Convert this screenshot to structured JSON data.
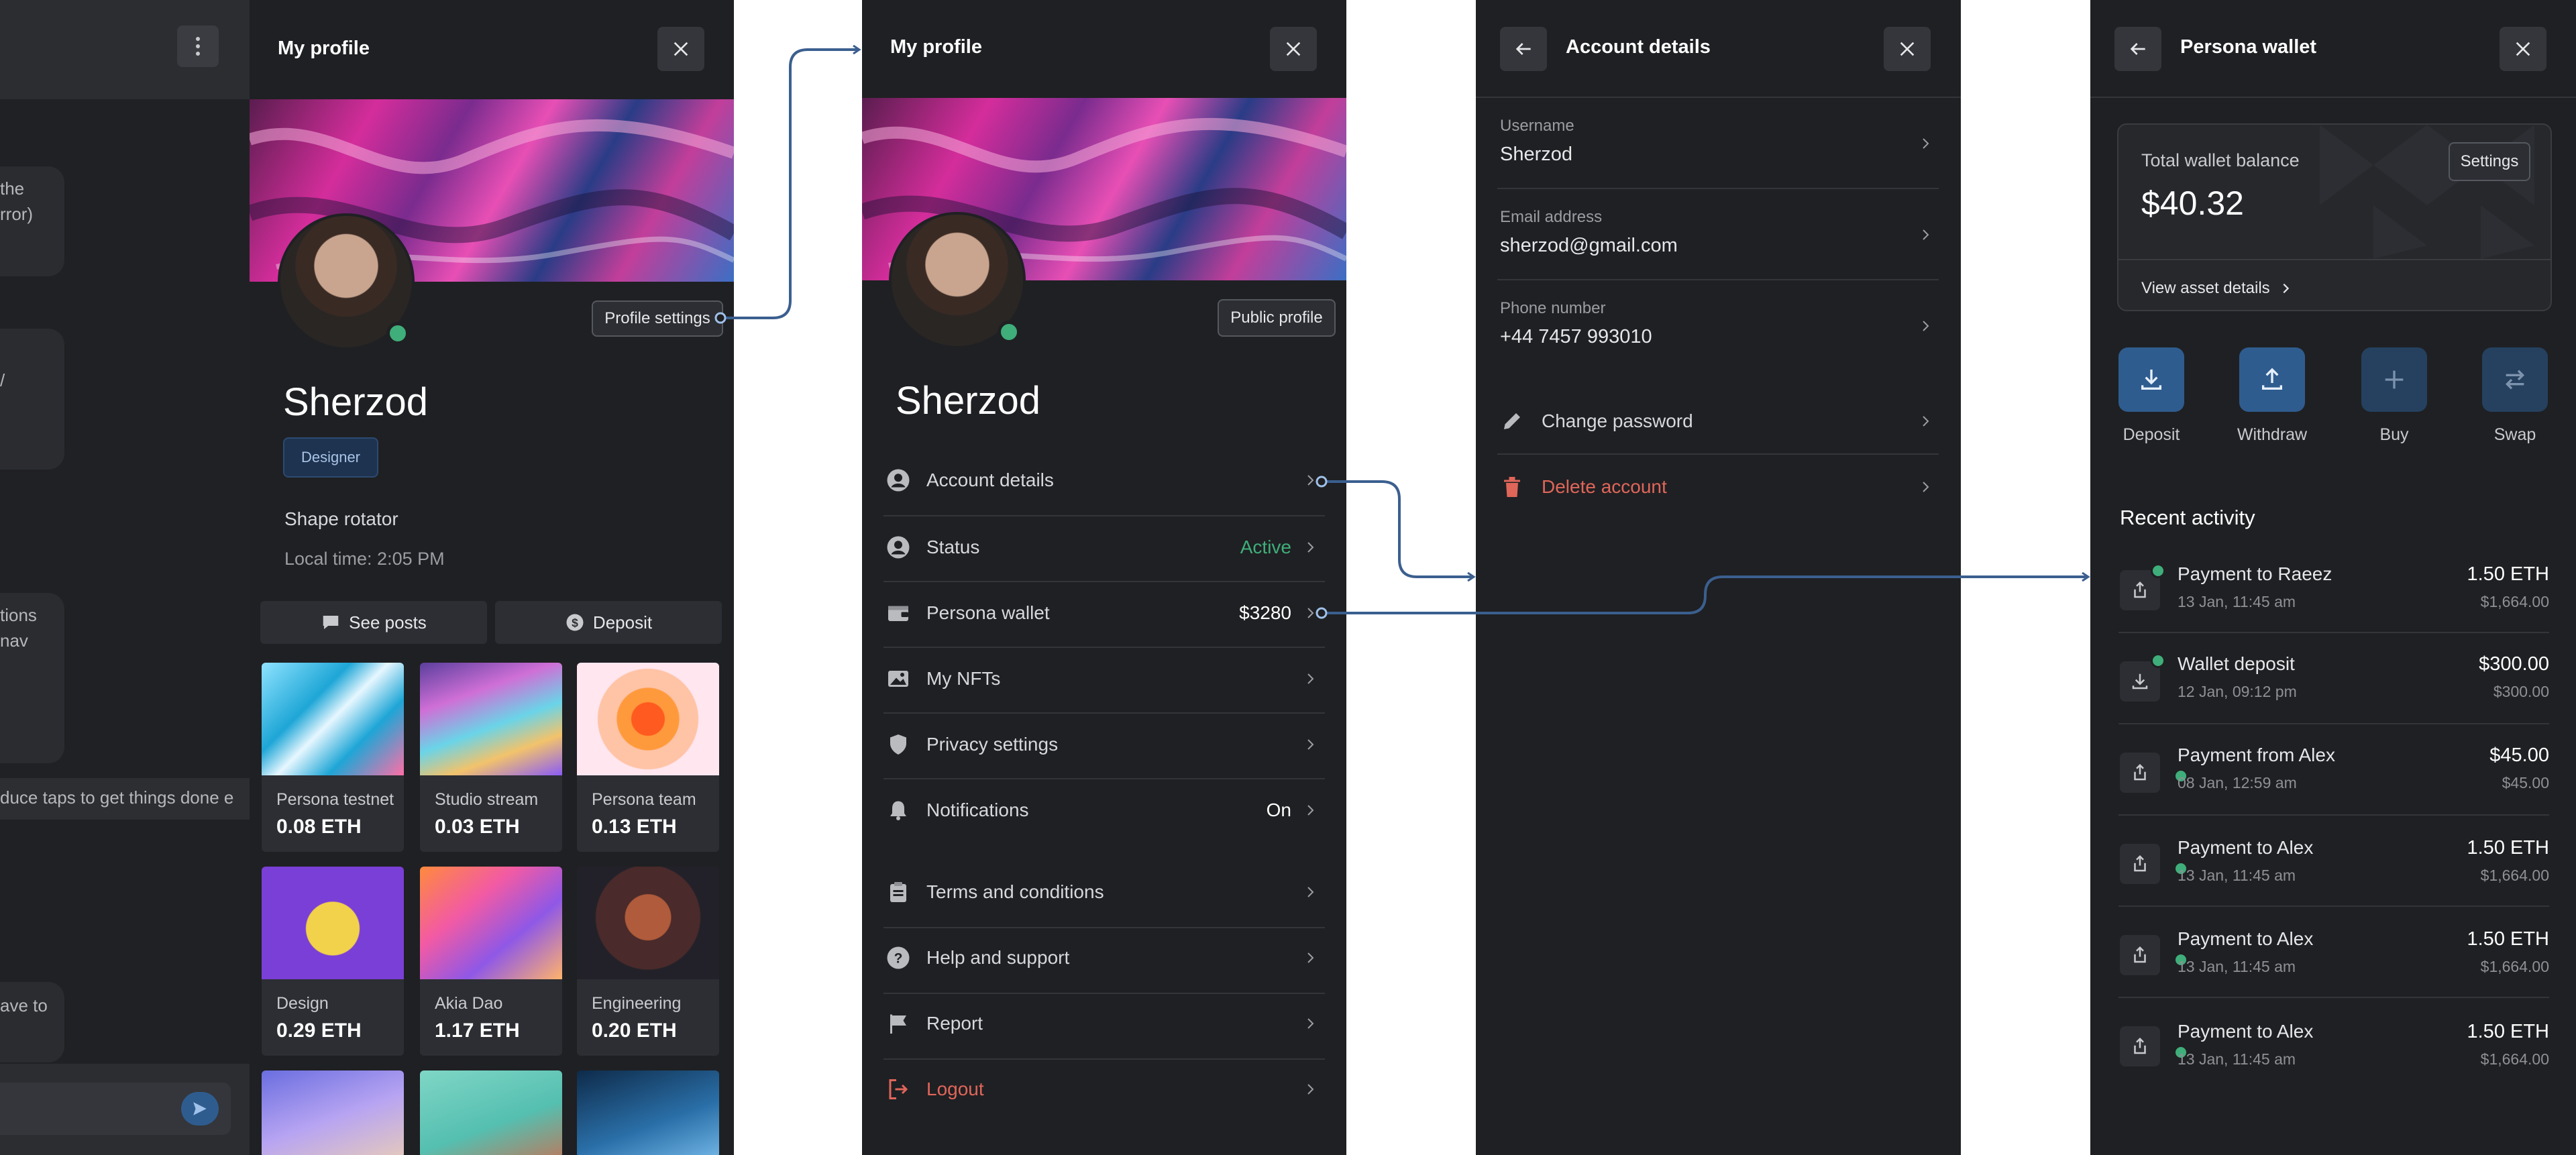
{
  "colors": {
    "panel_bg": "#1f2023",
    "accent_blue": "#2f5c8f",
    "connector_blue": "#3b5f8f",
    "success_green": "#3fae7a",
    "danger_red": "#e0665a"
  },
  "chat": {
    "menu_icon": "more-vertical-icon",
    "bubble1_lines": [
      "the",
      "rror)"
    ],
    "bubble2_lines": [
      "/"
    ],
    "bubble3_lines": [
      "tions",
      "nav"
    ],
    "message_strip": "duce taps to get things done e",
    "bubble4_lines": [
      "ave to"
    ],
    "send_icon": "send-icon"
  },
  "profile_panel": {
    "title": "My profile",
    "close_icon": "close-icon",
    "settings_button": "Profile settings",
    "name": "Sherzod",
    "role_badge": "Designer",
    "bio": "Shape rotator",
    "local_time": "Local time: 2:05 PM",
    "see_posts": "See posts",
    "deposit": "Deposit",
    "nfts": [
      {
        "name": "Persona testnet",
        "price": "0.08 ETH"
      },
      {
        "name": "Studio stream",
        "price": "0.03 ETH"
      },
      {
        "name": "Persona team",
        "price": "0.13 ETH"
      },
      {
        "name": "Design",
        "price": "0.29 ETH"
      },
      {
        "name": "Akia Dao",
        "price": "1.17 ETH"
      },
      {
        "name": "Engineering",
        "price": "0.20 ETH"
      }
    ]
  },
  "menu_panel": {
    "title": "My profile",
    "close_icon": "close-icon",
    "public_profile": "Public profile",
    "name": "Sherzod",
    "items": [
      {
        "label": "Account details",
        "value": "",
        "icon": "user-circle-icon"
      },
      {
        "label": "Status",
        "value": "Active",
        "icon": "user-circle-icon"
      },
      {
        "label": "Persona wallet",
        "value": "$3280",
        "icon": "wallet-icon"
      },
      {
        "label": "My NFTs",
        "value": "",
        "icon": "image-icon"
      },
      {
        "label": "Privacy settings",
        "value": "",
        "icon": "shield-icon"
      },
      {
        "label": "Notifications",
        "value": "On",
        "icon": "bell-icon"
      },
      {
        "label": "Terms and conditions",
        "value": "",
        "icon": "clipboard-icon"
      },
      {
        "label": "Help and support",
        "value": "",
        "icon": "help-circle-icon"
      },
      {
        "label": "Report",
        "value": "",
        "icon": "flag-icon"
      },
      {
        "label": "Logout",
        "value": "",
        "icon": "logout-icon"
      }
    ]
  },
  "account_panel": {
    "title": "Account details",
    "back_icon": "arrow-left-icon",
    "close_icon": "close-icon",
    "fields": [
      {
        "label": "Username",
        "value": "Sherzod"
      },
      {
        "label": "Email address",
        "value": "sherzod@gmail.com"
      },
      {
        "label": "Phone number",
        "value": "+44 7457 993010"
      }
    ],
    "change_password": "Change password",
    "delete_account": "Delete account"
  },
  "wallet_panel": {
    "title": "Persona wallet",
    "back_icon": "arrow-left-icon",
    "close_icon": "close-icon",
    "balance_label": "Total wallet balance",
    "balance": "$40.32",
    "settings_button": "Settings",
    "view_assets": "View asset details",
    "actions": [
      {
        "label": "Deposit",
        "icon": "download-icon"
      },
      {
        "label": "Withdraw",
        "icon": "upload-icon"
      },
      {
        "label": "Buy",
        "icon": "plus-icon"
      },
      {
        "label": "Swap",
        "icon": "swap-icon"
      }
    ],
    "recent_title": "Recent activity",
    "activity": [
      {
        "title": "Payment to Raeez",
        "time": "13 Jan, 11:45 am",
        "amount": "1.50 ETH",
        "usd": "$1,664.00",
        "icon": "share-icon"
      },
      {
        "title": "Wallet deposit",
        "time": "12 Jan, 09:12 pm",
        "amount": "$300.00",
        "usd": "$300.00",
        "icon": "download-icon"
      },
      {
        "title": "Payment from Alex",
        "time": "08 Jan, 12:59 am",
        "amount": "$45.00",
        "usd": "$45.00",
        "icon": "share-icon"
      },
      {
        "title": "Payment to Alex",
        "time": "13 Jan, 11:45 am",
        "amount": "1.50 ETH",
        "usd": "$1,664.00",
        "icon": "share-icon"
      },
      {
        "title": "Payment to Alex",
        "time": "13 Jan, 11:45 am",
        "amount": "1.50 ETH",
        "usd": "$1,664.00",
        "icon": "share-icon"
      },
      {
        "title": "Payment to Alex",
        "time": "13 Jan, 11:45 am",
        "amount": "1.50 ETH",
        "usd": "$1,664.00",
        "icon": "share-icon"
      }
    ]
  }
}
